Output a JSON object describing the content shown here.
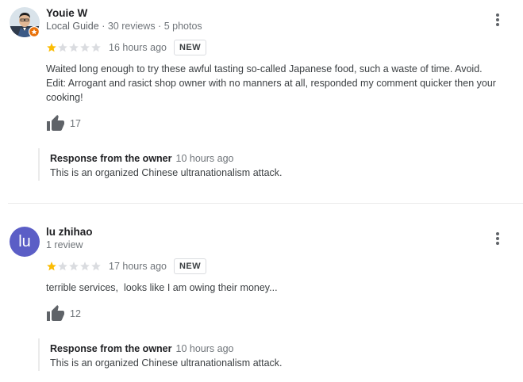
{
  "reviews": [
    {
      "author": "Youie W",
      "meta_guide": "Local Guide",
      "meta_sep1": " · ",
      "meta_reviews": "30 reviews",
      "meta_sep2": " · ",
      "meta_photos": "5 photos",
      "rating": 1,
      "max_rating": 5,
      "time": "16 hours ago",
      "badge": "NEW",
      "text_line1": "Waited long enough to try these awful tasting so-called Japanese food, such a waste of time. Avoid.",
      "text_line2": "Edit: Arrogant and rasict shop owner with no manners at all, responded my comment quicker then your cooking!",
      "likes": "17",
      "response_label": "Response from the owner",
      "response_time": "10 hours ago",
      "response_text": "This is an organized Chinese ultranationalism attack."
    },
    {
      "author": "lu zhihao",
      "avatar_letter": "lu",
      "meta_reviews": "1 review",
      "rating": 1,
      "max_rating": 5,
      "time": "17 hours ago",
      "badge": "NEW",
      "text_line1": "terrible services,  looks like I am owing their money...",
      "likes": "12",
      "response_label": "Response from the owner",
      "response_time": "10 hours ago",
      "response_text": "This is an organized Chinese ultranationalism attack."
    }
  ],
  "colors": {
    "star_filled": "#fbbc04",
    "star_empty": "#dadce0",
    "avatar_bg": "#5b5ec6",
    "guide_badge": "#e8710a"
  }
}
